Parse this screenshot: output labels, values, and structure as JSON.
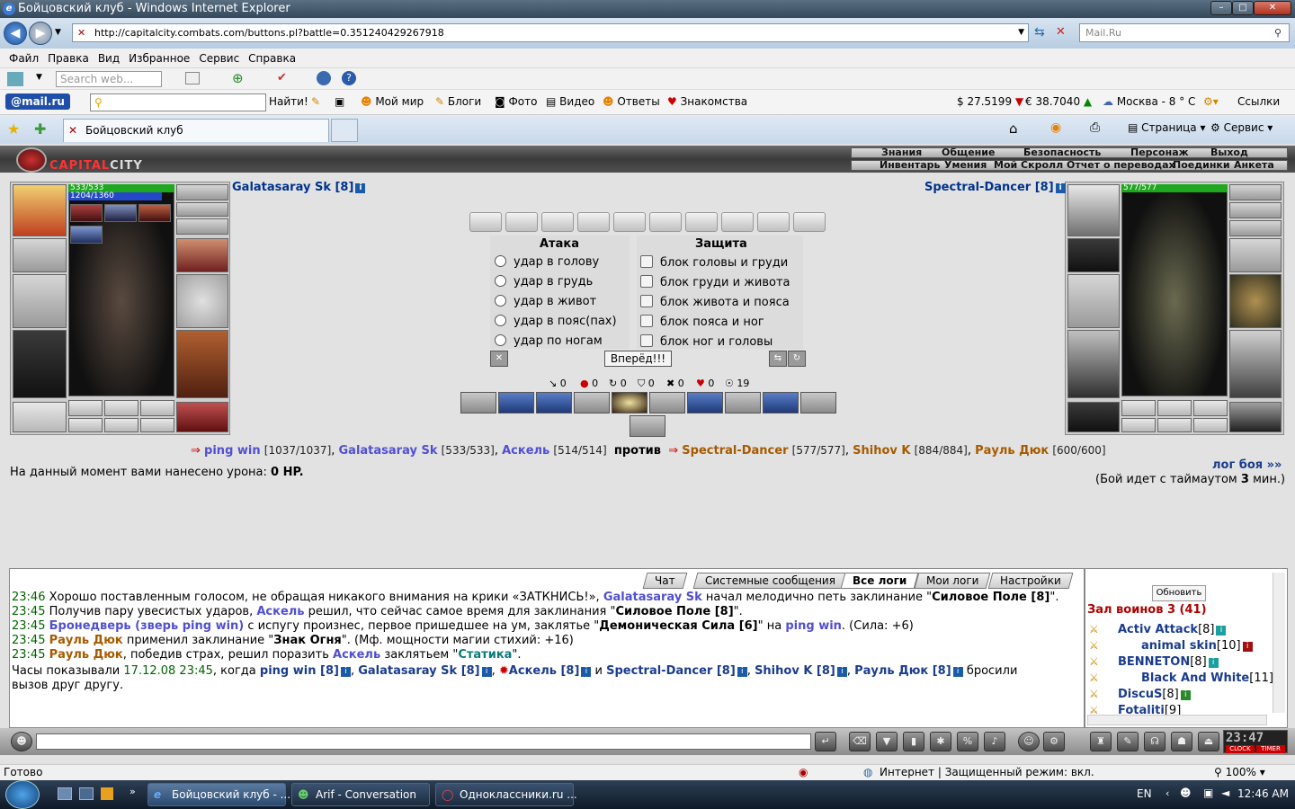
{
  "window": {
    "title": "Бойцовский клуб - Windows Internet Explorer",
    "min": "–",
    "max": "□",
    "close": "✕"
  },
  "address": {
    "url": "http://capitalcity.combats.com/buttons.pl?battle=0.351240429267918",
    "search_placeholder": "Mail.Ru"
  },
  "menu": [
    "Файл",
    "Правка",
    "Вид",
    "Избранное",
    "Сервис",
    "Справка"
  ],
  "toolbar1": {
    "search_placeholder": "Search web..."
  },
  "toolbar2": {
    "logo": "@mail.ru",
    "find": "Найти!",
    "links": [
      "Мой мир",
      "Блоги",
      "Фото",
      "Видео",
      "Ответы",
      "Знакомства"
    ],
    "usd": "$ 27.5199",
    "eur": "€ 38.7040",
    "weather": "Москва - 8 ° C",
    "links_label": "Ссылки"
  },
  "tabs": {
    "active": "Бойцовский клуб",
    "page": "Страница",
    "service": "Сервис"
  },
  "game": {
    "logo_a": "CAPITAL",
    "logo_b": "CITY",
    "nav_top": [
      "Знания",
      "Общение",
      "Безопасность",
      "Персонаж",
      "Выход"
    ],
    "nav_bottom": [
      "Инвентарь",
      "Умения",
      "Мой Скролл",
      "Отчет о переводах",
      "Поединки",
      "Анкета"
    ],
    "player_left": {
      "name": "Galatasaray Sk [8]",
      "hp": "533/533",
      "mp": "1204/1360",
      "hp_fraction": 1.0,
      "mp_fraction": 0.885
    },
    "player_right": {
      "name": "Spectral-Dancer [8]",
      "hp": "577/577",
      "hp_fraction": 1.0
    },
    "attack_title": "Атака",
    "defense_title": "Защита",
    "attacks": [
      "удар в голову",
      "удар в грудь",
      "удар в живот",
      "удар в пояс(пах)",
      "удар по ногам"
    ],
    "defenses": [
      "блок головы и груди",
      "блок груди и живота",
      "блок живота и пояса",
      "блок пояса и ног",
      "блок ног и головы"
    ],
    "go_button": "Вперёд!!!",
    "counters": [
      "0",
      "0",
      "0",
      "0",
      "0",
      "0",
      "19"
    ],
    "versus": {
      "arrow": "⇒",
      "t1": [
        {
          "n": "ping win",
          "hp": "[1037/1037]"
        },
        {
          "n": "Galatasaray Sk",
          "hp": "[533/533]"
        },
        {
          "n": "Аскель",
          "hp": "[514/514]"
        }
      ],
      "vs": "против",
      "t2": [
        {
          "n": "Spectral-Dancer",
          "hp": "[577/577]"
        },
        {
          "n": "Shihov K",
          "hp": "[884/884]"
        },
        {
          "n": "Рауль Дюк",
          "hp": "[600/600]"
        }
      ]
    },
    "damage_prefix": "На данный момент вами нанесено урона:",
    "damage_value": "0 HP.",
    "log_link": "лог боя »»",
    "timeout_prefix": "(Бой идет с таймаутом",
    "timeout_value": "3",
    "timeout_suffix": "мин.)",
    "log_tabs": [
      "Чат",
      "Системные сообщения",
      "Все логи",
      "Мои логи",
      "Настройки"
    ],
    "log": [
      {
        "time": "23:46",
        "a": "Хорошо поставленным голосом, не обращая никакого внимания на крики «ЗАТКНИСЬ!»,",
        "n": "Galatasaray Sk",
        "b": "начал мелодично петь заклинание \"",
        "s": "Силовое Поле [8]",
        "c": "\"."
      },
      {
        "time": "23:45",
        "a": "Получив пару увесистых ударов,",
        "n": "Аскель",
        "b": "решил, что сейчас самое время для заклинания \"",
        "s": "Силовое Поле [8]",
        "c": "\"."
      },
      {
        "time": "23:45",
        "n": "Бронедверь (зверь ping win)",
        "a": "с испугу произнес, первое пришедшее на ум, заклятье \"",
        "s": "Демоническая Сила [6]",
        "b": "\" на",
        "n2": "ping win",
        "c": ". (Сила: +6)"
      },
      {
        "time": "23:45",
        "n": "Рауль Дюк",
        "a": "применил заклинание \"",
        "s": "Знак Огня",
        "c": "\". (Мф. мощности магии стихий: +16)"
      },
      {
        "time": "23:45",
        "n": "Рауль Дюк",
        "a": ", победив страх, решил поразить",
        "n2": "Аскель",
        "b": "заклятьем \"",
        "s": "Статика",
        "c": "\"."
      }
    ],
    "clock_line": {
      "a": "Часы показывали",
      "time": "17.12.08 23:45",
      "b": ", когда",
      "p1": "ping win [8]",
      "p2": "Galatasaray Sk [8]",
      "p3": "Аскель [8]",
      "and": "и",
      "p4": "Spectral-Dancer [8]",
      "p5": "Shihov K [8]",
      "p6": "Рауль Дюк [8]",
      "c": "бросили",
      "d": "вызов друг другу."
    },
    "refresh": "Обновить",
    "room": "Зал воинов 3 (41)",
    "users": [
      {
        "n": "Activ Attack",
        "l": "[8]"
      },
      {
        "n": "animal skin",
        "l": "[10]"
      },
      {
        "n": "BENNETON",
        "l": "[8]"
      },
      {
        "n": "Black And White",
        "l": "[11]"
      },
      {
        "n": "DiscuS",
        "l": "[8]"
      },
      {
        "n": "Fotaliti",
        "l": "[9]"
      }
    ],
    "clock": "23:47",
    "clock_label": "CLOCK",
    "timer_label": "TIMER"
  },
  "status": {
    "left": "Готово",
    "zone": "Интернет | Защищенный режим: вкл.",
    "zoom": "100%"
  },
  "taskbar": {
    "tasks": [
      "Бойцовский клуб - ...",
      "Arif - Conversation",
      "Одноклассники.ru ..."
    ],
    "lang": "EN",
    "time": "12:46 AM"
  }
}
